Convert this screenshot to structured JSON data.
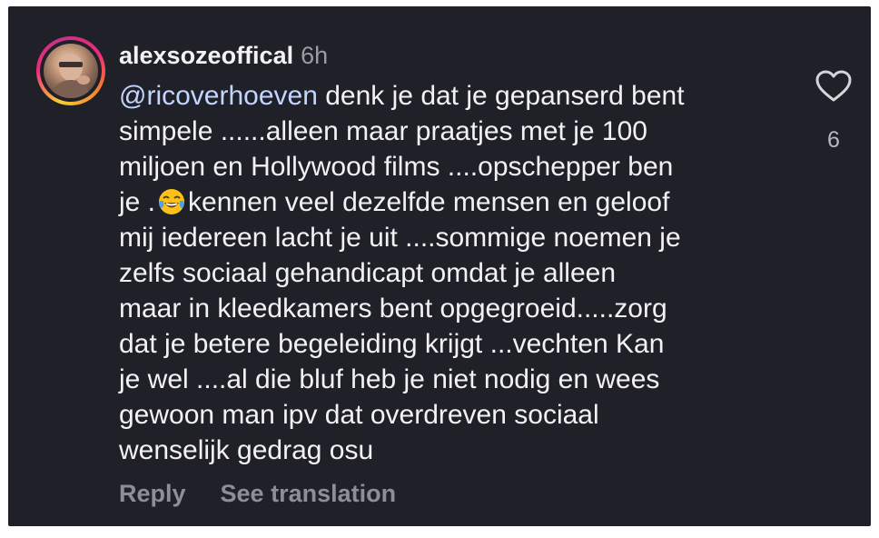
{
  "comment": {
    "username": "alexsozeoffical",
    "time": "6h",
    "mention": "@ricoverhoeven",
    "line1_rest": " denk je dat je gepanserd bent",
    "line2": "simpele ......alleen maar praatjes met je 100",
    "line3": "miljoen en Hollywood films ....opschepper ben",
    "line4_before_emoji": "je .",
    "emoji": "face-with-tears-of-joy-icon",
    "line4_after_emoji": "kennen veel dezelfde mensen en geloof",
    "line5": "mij iedereen lacht je uit ....sommige noemen je",
    "line6": "zelfs sociaal gehandicapt omdat je alleen",
    "line7": "maar in kleedkamers bent opgegroeid.....zorg",
    "line8": "dat je betere begeleiding krijgt ...vechten Kan",
    "line9": "je wel ....al die bluf heb je niet nodig en wees",
    "line10": "gewoon man ipv dat overdreven sociaal",
    "line11": "wenselijk gedrag osu",
    "like_count": "6"
  },
  "actions": {
    "reply_label": "Reply",
    "translate_label": "See translation"
  },
  "icons": {
    "like": "heart-outline-icon"
  },
  "colors": {
    "background": "#202128",
    "text": "#f2f2f4",
    "mention": "#c3d5ff",
    "muted": "#8d8e96"
  }
}
